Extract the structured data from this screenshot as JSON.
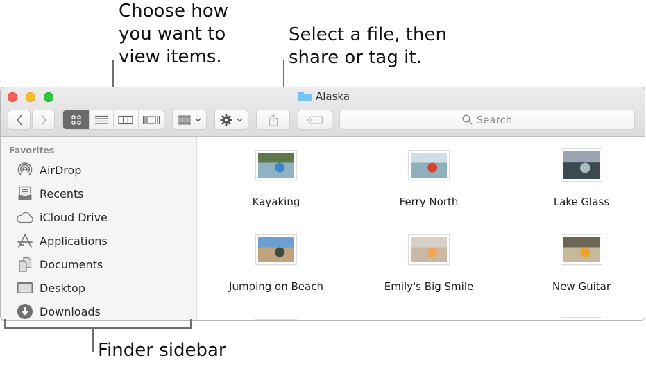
{
  "annotations": {
    "view_callout": "Choose how\nyou want to\nview items.",
    "share_callout": "Select a file, then\nshare or tag it.",
    "sidebar_callout": "Finder sidebar"
  },
  "window": {
    "title": "Alaska",
    "title_icon": "folder-icon"
  },
  "toolbar": {
    "back_icon": "chevron-left",
    "forward_icon": "chevron-right",
    "view_modes": [
      {
        "name": "icon-view",
        "icon": "grid-icon",
        "active": true
      },
      {
        "name": "list-view",
        "icon": "list-icon",
        "active": false
      },
      {
        "name": "column-view",
        "icon": "columns-icon",
        "active": false
      },
      {
        "name": "gallery-view",
        "icon": "gallery-icon",
        "active": false
      }
    ],
    "group_icon": "group-by-icon",
    "action_icon": "gear-icon",
    "share_icon": "share-icon",
    "tag_icon": "tag-icon",
    "search_placeholder": "Search"
  },
  "sidebar": {
    "section": "Favorites",
    "items": [
      {
        "label": "AirDrop",
        "icon": "airdrop-icon"
      },
      {
        "label": "Recents",
        "icon": "recents-icon"
      },
      {
        "label": "iCloud Drive",
        "icon": "icloud-icon"
      },
      {
        "label": "Applications",
        "icon": "applications-icon"
      },
      {
        "label": "Documents",
        "icon": "documents-icon"
      },
      {
        "label": "Desktop",
        "icon": "desktop-icon"
      },
      {
        "label": "Downloads",
        "icon": "downloads-icon"
      }
    ]
  },
  "files": [
    {
      "name": "Kayaking",
      "colors": [
        "#5f7a4a",
        "#8fb2c4",
        "#3a86c8"
      ]
    },
    {
      "name": "Ferry North",
      "colors": [
        "#cfdde4",
        "#8eb1bd",
        "#d8422c"
      ]
    },
    {
      "name": "Lake Glass",
      "colors": [
        "#9aa4b0",
        "#3b4a4e",
        "#a9bcbe"
      ]
    },
    {
      "name": "Jumping on Beach",
      "colors": [
        "#6d9ed0",
        "#bfa27e",
        "#3e4a3c"
      ]
    },
    {
      "name": "Emily's Big Smile",
      "colors": [
        "#d8d0c6",
        "#c8b8a4",
        "#f2a357"
      ]
    },
    {
      "name": "New Guitar",
      "colors": [
        "#6d6555",
        "#c6b89b",
        "#e8a22d"
      ]
    }
  ]
}
